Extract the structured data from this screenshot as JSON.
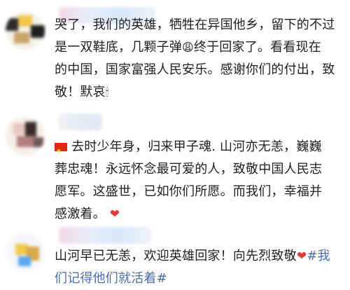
{
  "comments": [
    {
      "username": "",
      "line1": "哭了，我们的英雄，牺牲在异国他乡，留下的不过",
      "line2": "是一双鞋底，几颗子弹",
      "line2_emoji": "😩",
      "line2_tail": "终于回家了。看看现在",
      "line3": "的中国，国家富强人民安乐。感谢你们的付出，致",
      "line4": "敬！默哀",
      "line4_emoji": "🕯"
    },
    {
      "username": "",
      "line1": "去时少年身，归来甲子魂. 山河亦无恙，巍巍",
      "line2": "葬忠魂！永远怀念最可爱的人，致敬中国人民志",
      "line3": "愿军。这盛世，已如你们所愿。而我们，幸福并",
      "line4": "感激着。",
      "heart": "❤"
    },
    {
      "username": "",
      "line1": "山河早已无恙，欢迎英雄回家！向先烈致敬",
      "heart": "❤",
      "hashtag_part1": "#我",
      "line2": "们记得他们就活着#"
    }
  ],
  "icons": {
    "flag": "china-flag-icon",
    "heart": "heart-icon",
    "emoji1": "grimace-emoji-icon",
    "emoji2": "candle-emoji-icon"
  },
  "colors": {
    "hashtag": "#4c6ea8",
    "heart": "#e53a3a"
  }
}
